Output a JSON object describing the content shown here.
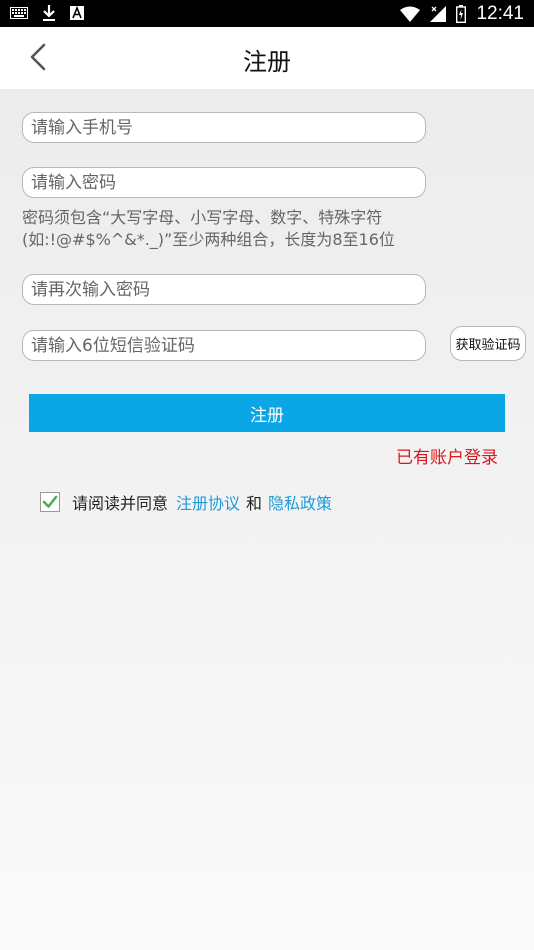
{
  "status_bar": {
    "time": "12:41"
  },
  "header": {
    "title": "注册"
  },
  "form": {
    "phone_placeholder": "请输入手机号",
    "password_placeholder": "请输入密码",
    "password_hint": "密码须包含“大写字母、小写字母、数字、特殊字符(如:!@#$%^&*._)”至少两种组合，长度为8至16位",
    "confirm_placeholder": "请再次输入密码",
    "sms_placeholder": "请输入6位短信验证码",
    "get_code_label": "获取验证码",
    "submit_label": "注册",
    "login_link": "已有账户登录"
  },
  "agreement": {
    "checked": true,
    "prefix": "请阅读并同意",
    "terms_link": "注册协议",
    "and": "和",
    "privacy_link": "隐私政策"
  },
  "colors": {
    "accent": "#0aa6e6",
    "link": "#1c9bd8",
    "login_link": "#d9181c",
    "checkbox_check": "#4caf50"
  }
}
